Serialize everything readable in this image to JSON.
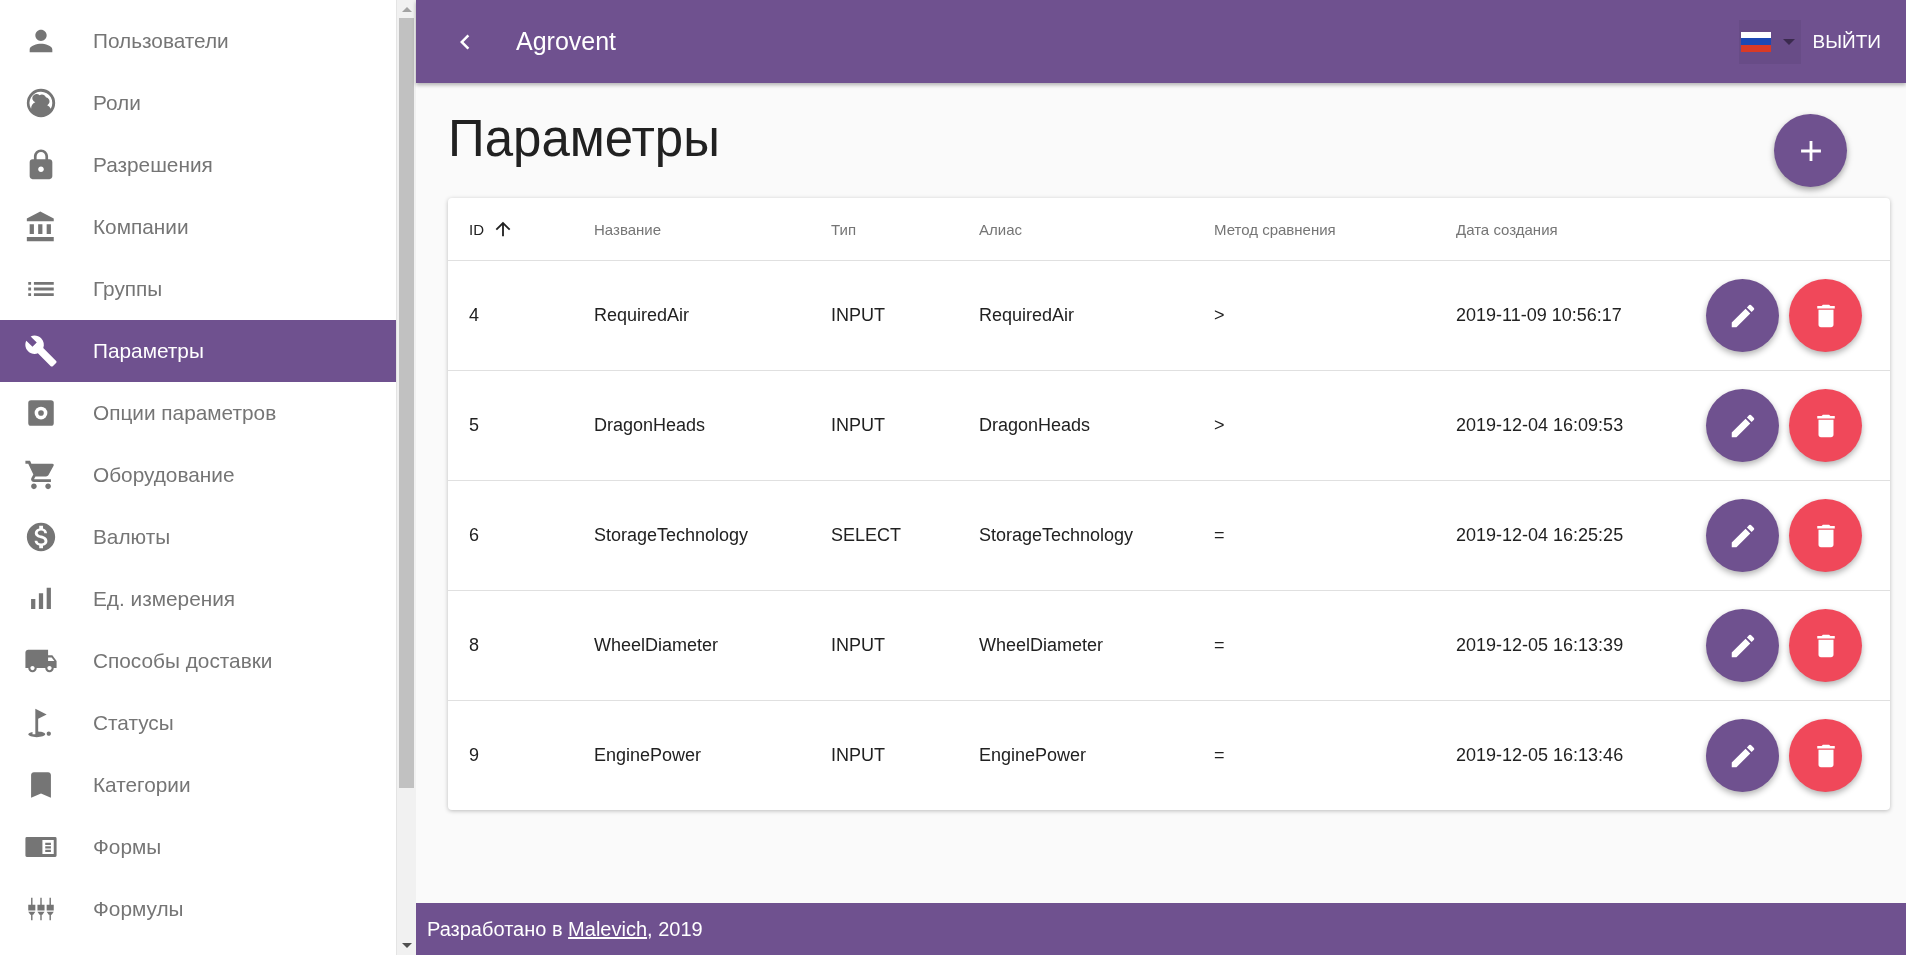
{
  "sidebar": {
    "items": [
      {
        "label": "Пользователи",
        "selected": false
      },
      {
        "label": "Роли",
        "selected": false
      },
      {
        "label": "Разрешения",
        "selected": false
      },
      {
        "label": "Компании",
        "selected": false
      },
      {
        "label": "Группы",
        "selected": false
      },
      {
        "label": "Параметры",
        "selected": true
      },
      {
        "label": "Опции параметров",
        "selected": false
      },
      {
        "label": "Оборудование",
        "selected": false
      },
      {
        "label": "Валюты",
        "selected": false
      },
      {
        "label": "Ед. измерения",
        "selected": false
      },
      {
        "label": "Способы доставки",
        "selected": false
      },
      {
        "label": "Статусы",
        "selected": false
      },
      {
        "label": "Категории",
        "selected": false
      },
      {
        "label": "Формы",
        "selected": false
      },
      {
        "label": "Формулы",
        "selected": false
      }
    ]
  },
  "header": {
    "title": "Agrovent",
    "logout": "ВЫЙТИ"
  },
  "page": {
    "title": "Параметры"
  },
  "table": {
    "columns": [
      {
        "label": "ID",
        "sorted": true
      },
      {
        "label": "Название",
        "sorted": false
      },
      {
        "label": "Тип",
        "sorted": false
      },
      {
        "label": "Алиас",
        "sorted": false
      },
      {
        "label": "Метод сравнения",
        "sorted": false
      },
      {
        "label": "Дата создания",
        "sorted": false
      }
    ],
    "rows": [
      [
        "4",
        "RequiredAir",
        "INPUT",
        "RequiredAir",
        ">",
        "2019-11-09 10:56:17"
      ],
      [
        "5",
        "DragonHeads",
        "INPUT",
        "DragonHeads",
        ">",
        "2019-12-04 16:09:53"
      ],
      [
        "6",
        "StorageTechnology",
        "SELECT",
        "StorageTechnology",
        "=",
        "2019-12-04 16:25:25"
      ],
      [
        "8",
        "WheelDiameter",
        "INPUT",
        "WheelDiameter",
        "=",
        "2019-12-05 16:13:39"
      ],
      [
        "9",
        "EnginePower",
        "INPUT",
        "EnginePower",
        "=",
        "2019-12-05 16:13:46"
      ]
    ]
  },
  "footer": {
    "prefix": "Разработано в",
    "link": "Malevich",
    "suffix": ", 2019"
  }
}
